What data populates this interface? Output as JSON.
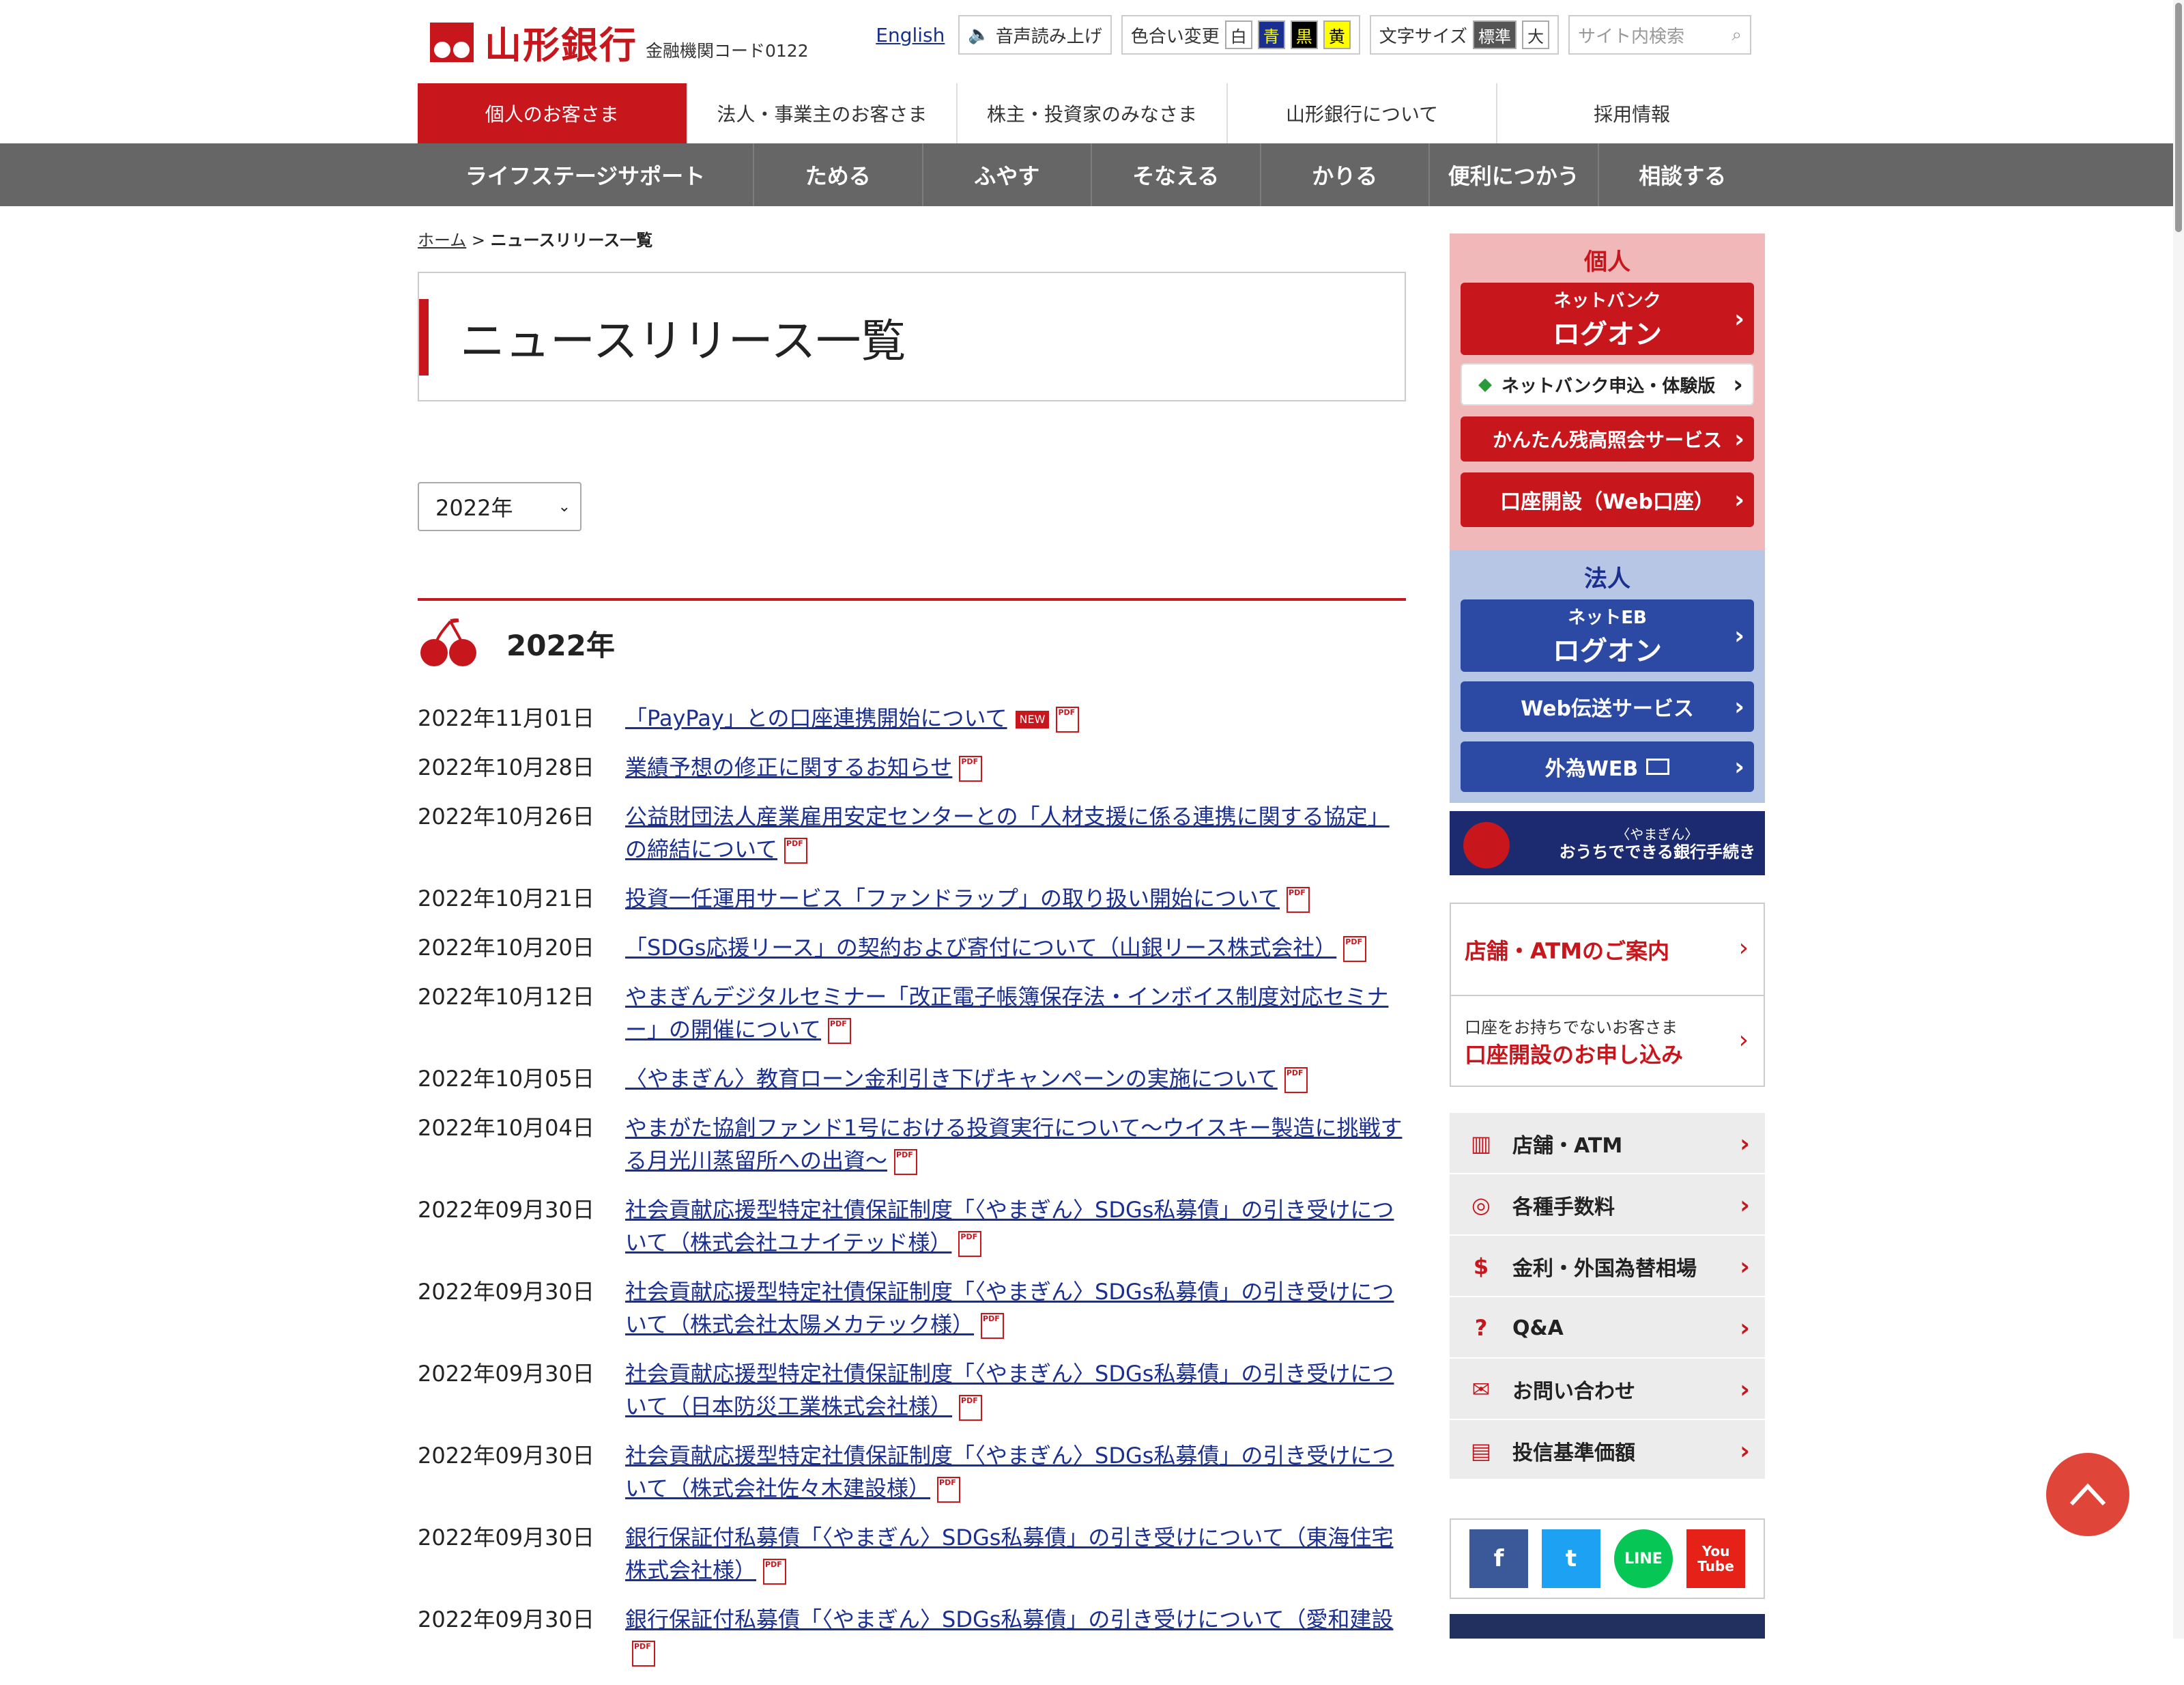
{
  "header": {
    "bank_name": "山形銀行",
    "bank_code": "金融機関コード0122",
    "english_link": "English",
    "voice_read": "音声読み上げ",
    "color_change_label": "色合い変更",
    "color_options": [
      "白",
      "青",
      "黒",
      "黄"
    ],
    "font_size_label": "文字サイズ",
    "font_options": [
      "標準",
      "大"
    ],
    "search_placeholder": "サイト内検索"
  },
  "main_nav": [
    "個人のお客さま",
    "法人・事業主のお客さま",
    "株主・投資家のみなさま",
    "山形銀行について",
    "採用情報"
  ],
  "sub_nav": [
    "ライフステージサポート",
    "ためる",
    "ふやす",
    "そなえる",
    "かりる",
    "便利につかう",
    "相談する"
  ],
  "breadcrumb": {
    "home": "ホーム",
    "sep": ">",
    "current": "ニュースリリース一覧"
  },
  "page_title": "ニュースリリース一覧",
  "year_select": "2022年",
  "year_heading": "2022年",
  "news_new_badge": "NEW",
  "news": [
    {
      "date": "2022年11月01日",
      "title": "「PayPay」との口座連携開始について"
    },
    {
      "date": "2022年10月28日",
      "title": "業績予想の修正に関するお知らせ"
    },
    {
      "date": "2022年10月26日",
      "title": "公益財団法人産業雇用安定センターとの「人材支援に係る連携に関する協定」の締結について"
    },
    {
      "date": "2022年10月21日",
      "title": "投資一任運用サービス「ファンドラップ」の取り扱い開始について"
    },
    {
      "date": "2022年10月20日",
      "title": "「SDGs応援リース」の契約および寄付について（山銀リース株式会社）"
    },
    {
      "date": "2022年10月12日",
      "title": "やまぎんデジタルセミナー「改正電子帳簿保存法・インボイス制度対応セミナー」の開催について"
    },
    {
      "date": "2022年10月05日",
      "title": "〈やまぎん〉教育ローン金利引き下げキャンペーンの実施について"
    },
    {
      "date": "2022年10月04日",
      "title": "やまがた協創ファンド1号における投資実行について～ウイスキー製造に挑戦する月光川蒸留所への出資～"
    },
    {
      "date": "2022年09月30日",
      "title": "社会貢献応援型特定社債保証制度「〈やまぎん〉SDGs私募債」の引き受けについて（株式会社ユナイテッド様）"
    },
    {
      "date": "2022年09月30日",
      "title": "社会貢献応援型特定社債保証制度「〈やまぎん〉SDGs私募債」の引き受けについて（株式会社太陽メカテック様）"
    },
    {
      "date": "2022年09月30日",
      "title": "社会貢献応援型特定社債保証制度「〈やまぎん〉SDGs私募債」の引き受けについて（日本防災工業株式会社様）"
    },
    {
      "date": "2022年09月30日",
      "title": "社会貢献応援型特定社債保証制度「〈やまぎん〉SDGs私募債」の引き受けについて（株式会社佐々木建設様）"
    },
    {
      "date": "2022年09月30日",
      "title": "銀行保証付私募債「〈やまぎん〉SDGs私募債」の引き受けについて（東海住宅株式会社様）"
    },
    {
      "date": "2022年09月30日",
      "title": "銀行保証付私募債「〈やまぎん〉SDGs私募債」の引き受けについて（愛和建設"
    }
  ],
  "side": {
    "kojin_head": "個人",
    "netbank_small": "ネットバンク",
    "netbank_big": "ログオン",
    "netbank_apply": "ネットバンク申込・体験版",
    "balance_service": "かんたん残高照会サービス",
    "account_open": "口座開設（Web口座）",
    "hojin_head": "法人",
    "neteb_small": "ネットEB",
    "neteb_big": "ログオン",
    "web_transfer": "Web伝送サービス",
    "fx_web": "外為WEB",
    "banner_small": "〈やまぎん〉",
    "banner_big": "おうちでできる銀行手続き",
    "store_atm_guide": "店舗・ATMのご案内",
    "no_account_small": "口座をお持ちでないお客さま",
    "no_account_big": "口座開設のお申し込み",
    "menu": [
      "店舗・ATM",
      "各種手数料",
      "金利・外国為替相場",
      "Q&A",
      "お問い合わせ",
      "投信基準価額"
    ],
    "social": [
      "f",
      "t",
      "LINE",
      "You Tube"
    ]
  },
  "colors": {
    "brand_red": "#c8161d",
    "brand_blue": "#2c4aa3",
    "subnav_gray": "#666666"
  }
}
